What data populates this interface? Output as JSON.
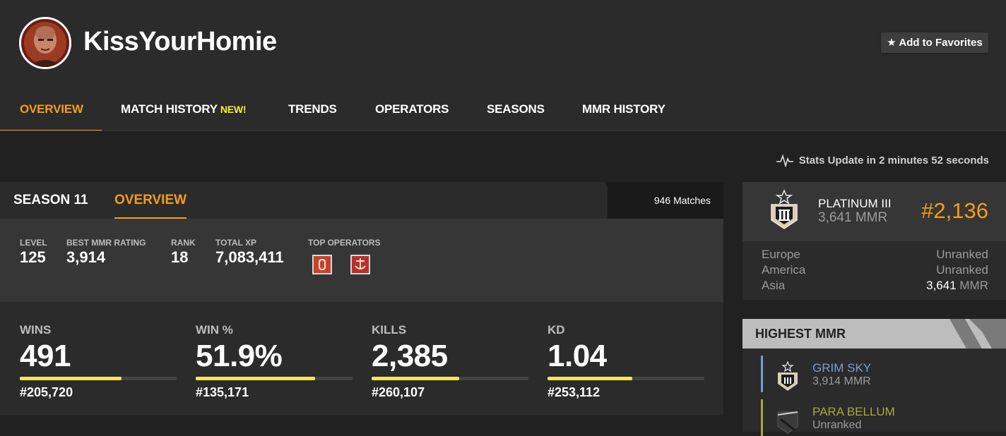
{
  "player": {
    "name": "KissYourHomie"
  },
  "header": {
    "favorite_label": "★ Add to Favorites"
  },
  "nav": {
    "items": [
      {
        "label": "OVERVIEW",
        "active": true
      },
      {
        "label": "MATCH HISTORY",
        "badge": "NEW!"
      },
      {
        "label": "TRENDS"
      },
      {
        "label": "OPERATORS"
      },
      {
        "label": "SEASONS"
      },
      {
        "label": "MMR HISTORY"
      }
    ]
  },
  "stats_update": "Stats Update in 2 minutes 52 seconds",
  "season_panel": {
    "season_label": "SEASON 11",
    "tab_label": "OVERVIEW",
    "matches": "946 Matches",
    "info": [
      {
        "label": "LEVEL",
        "value": "125"
      },
      {
        "label": "BEST MMR RATING",
        "value": "3,914"
      },
      {
        "label": "RANK",
        "value": "18"
      },
      {
        "label": "TOTAL XP",
        "value": "7,083,411"
      }
    ],
    "top_operators_label": "TOP OPERATORS",
    "top_operators": [
      {
        "icon": "operator-shield-icon",
        "color": "#c8412a"
      },
      {
        "icon": "operator-anchor-icon",
        "color": "#b8302a"
      }
    ],
    "stats": [
      {
        "label": "WINS",
        "value": "491",
        "rank": "#205,720",
        "bar_fraction": 0.65
      },
      {
        "label": "WIN %",
        "value": "51.9%",
        "rank": "#135,171",
        "bar_fraction": 0.76
      },
      {
        "label": "KILLS",
        "value": "2,385",
        "rank": "#260,107",
        "bar_fraction": 0.56
      },
      {
        "label": "KD",
        "value": "1.04",
        "rank": "#253,112",
        "bar_fraction": 0.54
      }
    ]
  },
  "rank_card": {
    "rank_name": "PLATINUM III",
    "mmr": "3,641 MMR",
    "position": "#2,136",
    "regions": [
      {
        "region": "Europe",
        "value": "Unranked"
      },
      {
        "region": "America",
        "value": "Unranked"
      },
      {
        "region": "Asia",
        "value_number": "3,641",
        "value_unit": " MMR"
      }
    ]
  },
  "highest_mmr": {
    "title": "HIGHEST MMR",
    "items": [
      {
        "season": "GRIM SKY",
        "sub": "3,914 MMR",
        "color": "#7a9ccc"
      },
      {
        "season": "PARA BELLUM",
        "sub": "Unranked",
        "color": "#a4a83a"
      }
    ]
  },
  "colors": {
    "accent": "#f39c1f",
    "bar": "#f1e65a",
    "new_badge": "#f6f12b"
  }
}
